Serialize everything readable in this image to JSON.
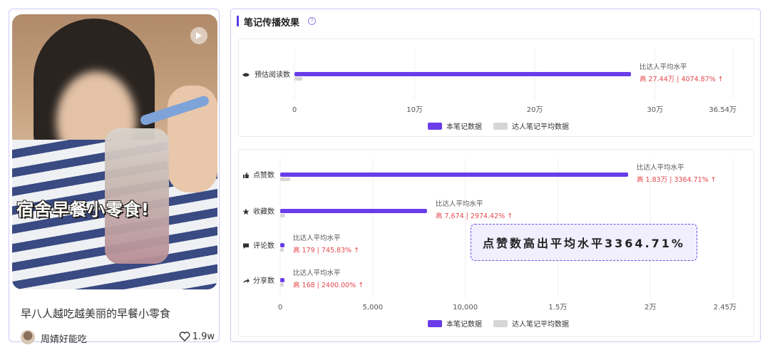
{
  "card": {
    "cover_title": "宿舍早餐小零食!",
    "title": "早八人越吃越美丽的早餐小零食",
    "author": "周婧好能吃",
    "likes": "1.9w"
  },
  "panel": {
    "title": "笔记传播效果",
    "help": "?"
  },
  "legend": {
    "note": "本笔记数据",
    "avg": "达人笔记平均数据"
  },
  "colors": {
    "note_bar": "#6a3de8",
    "avg_bar": "#d6d6d6",
    "up": "#e5484d"
  },
  "chart_data": [
    {
      "type": "bar",
      "orientation": "horizontal",
      "categories": [
        "预估阅读数"
      ],
      "series": [
        {
          "name": "本笔记数据",
          "values": [
            280000
          ]
        },
        {
          "name": "达人笔记平均数据",
          "values": [
            6700
          ]
        }
      ],
      "xlim": [
        0,
        365400
      ],
      "xticks": [
        {
          "v": 0,
          "label": "0"
        },
        {
          "v": 100000,
          "label": "10万"
        },
        {
          "v": 200000,
          "label": "20万"
        },
        {
          "v": 300000,
          "label": "30万"
        },
        {
          "v": 365400,
          "label": "36.54万"
        }
      ],
      "annotations": [
        {
          "line1": "比达人平均水平",
          "line2": "高 27.44万 | 4074.87% ↑"
        }
      ],
      "legend": "bottom"
    },
    {
      "type": "bar",
      "orientation": "horizontal",
      "categories": [
        "点赞数",
        "收藏数",
        "评论数",
        "分享数"
      ],
      "series": [
        {
          "name": "本笔记数据",
          "values": [
            18800,
            7932,
            203,
            175
          ]
        },
        {
          "name": "达人笔记平均数据",
          "values": [
            545,
            258,
            24,
            7
          ]
        }
      ],
      "xlim": [
        0,
        24500
      ],
      "xticks": [
        {
          "v": 0,
          "label": "0"
        },
        {
          "v": 5000,
          "label": "5,000"
        },
        {
          "v": 10000,
          "label": "10,000"
        },
        {
          "v": 15000,
          "label": "1.5万"
        },
        {
          "v": 20000,
          "label": "2万"
        },
        {
          "v": 24500,
          "label": "2.45万"
        }
      ],
      "annotations": [
        {
          "line1": "比达人平均水平",
          "line2": "高 1.83万 | 3364.71% ↑"
        },
        {
          "line1": "比达人平均水平",
          "line2": "高 7,674 | 2974.42% ↑"
        },
        {
          "line1": "比达人平均水平",
          "line2": "高 179 | 745.83% ↑"
        },
        {
          "line1": "比达人平均水平",
          "line2": "高 168 | 2400.00% ↑"
        }
      ],
      "legend": "bottom"
    }
  ],
  "callout": "点赞数高出平均水平3364.71%"
}
